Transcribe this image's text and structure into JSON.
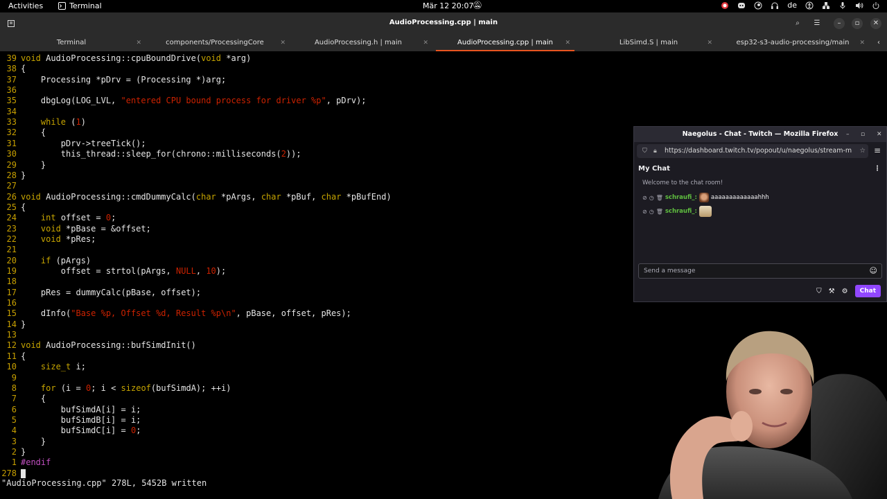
{
  "topbar": {
    "activities": "Activities",
    "app_name": "Terminal",
    "clock": "Mär 12  20:07",
    "language": "de"
  },
  "window": {
    "title": "AudioProcessing.cpp | main"
  },
  "tabs": [
    {
      "label": "Terminal"
    },
    {
      "label": "components/ProcessingCore"
    },
    {
      "label": "AudioProcessing.h | main"
    },
    {
      "label": "AudioProcessing.cpp | main"
    },
    {
      "label": "LibSimd.S | main"
    },
    {
      "label": "esp32-s3-audio-processing/main"
    }
  ],
  "code_lines": [
    {
      "n": "39",
      "code": "void AudioProcessing::cpuBoundDrive(void *arg)"
    },
    {
      "n": "38",
      "code": "{"
    },
    {
      "n": "37",
      "code": "    Processing *pDrv = (Processing *)arg;"
    },
    {
      "n": "36",
      "code": ""
    },
    {
      "n": "35",
      "code": "    dbgLog(LOG_LVL, \"entered CPU bound process for driver %p\", pDrv);"
    },
    {
      "n": "34",
      "code": ""
    },
    {
      "n": "33",
      "code": "    while (1)"
    },
    {
      "n": "32",
      "code": "    {"
    },
    {
      "n": "31",
      "code": "        pDrv->treeTick();"
    },
    {
      "n": "30",
      "code": "        this_thread::sleep_for(chrono::milliseconds(2));"
    },
    {
      "n": "29",
      "code": "    }"
    },
    {
      "n": "28",
      "code": "}"
    },
    {
      "n": "27",
      "code": ""
    },
    {
      "n": "26",
      "code": "void AudioProcessing::cmdDummyCalc(char *pArgs, char *pBuf, char *pBufEnd)"
    },
    {
      "n": "25",
      "code": "{"
    },
    {
      "n": "24",
      "code": "    int offset = 0;"
    },
    {
      "n": "23",
      "code": "    void *pBase = &offset;"
    },
    {
      "n": "22",
      "code": "    void *pRes;"
    },
    {
      "n": "21",
      "code": ""
    },
    {
      "n": "20",
      "code": "    if (pArgs)"
    },
    {
      "n": "19",
      "code": "        offset = strtol(pArgs, NULL, 10);"
    },
    {
      "n": "18",
      "code": ""
    },
    {
      "n": "17",
      "code": "    pRes = dummyCalc(pBase, offset);"
    },
    {
      "n": "16",
      "code": ""
    },
    {
      "n": "15",
      "code": "    dInfo(\"Base %p, Offset %d, Result %p\\n\", pBase, offset, pRes);"
    },
    {
      "n": "14",
      "code": "}"
    },
    {
      "n": "13",
      "code": ""
    },
    {
      "n": "12",
      "code": "void AudioProcessing::bufSimdInit()"
    },
    {
      "n": "11",
      "code": "{"
    },
    {
      "n": "10",
      "code": "    size_t i;"
    },
    {
      "n": "9",
      "code": ""
    },
    {
      "n": "8",
      "code": "    for (i = 0; i < sizeof(bufSimdA); ++i)"
    },
    {
      "n": "7",
      "code": "    {"
    },
    {
      "n": "6",
      "code": "        bufSimdA[i] = i;"
    },
    {
      "n": "5",
      "code": "        bufSimdB[i] = i;"
    },
    {
      "n": "4",
      "code": "        bufSimdC[i] = 0;"
    },
    {
      "n": "3",
      "code": "    }"
    },
    {
      "n": "2",
      "code": "}"
    },
    {
      "n": "1",
      "code": "#endif"
    },
    {
      "n": "278",
      "code": ""
    }
  ],
  "statusline": "\"AudioProcessing.cpp\" 278L, 5452B written",
  "firefox": {
    "title": "Naegolus - Chat - Twitch — Mozilla Firefox",
    "url": "https://dashboard.twitch.tv/popout/u/naegolus/stream-m",
    "chat": {
      "header": "My Chat",
      "welcome": "Welcome to the chat room!",
      "messages": [
        {
          "user": "schraufi_:",
          "text": "aaaaaaaaaaaaahhh"
        },
        {
          "user": "schraufi_:",
          "text": ""
        }
      ],
      "input_placeholder": "Send a message",
      "chat_button": "Chat"
    }
  },
  "colors": {
    "accent_orange": "#e95420",
    "twitch_purple": "#9147ff",
    "line_number": "#c8a000"
  }
}
